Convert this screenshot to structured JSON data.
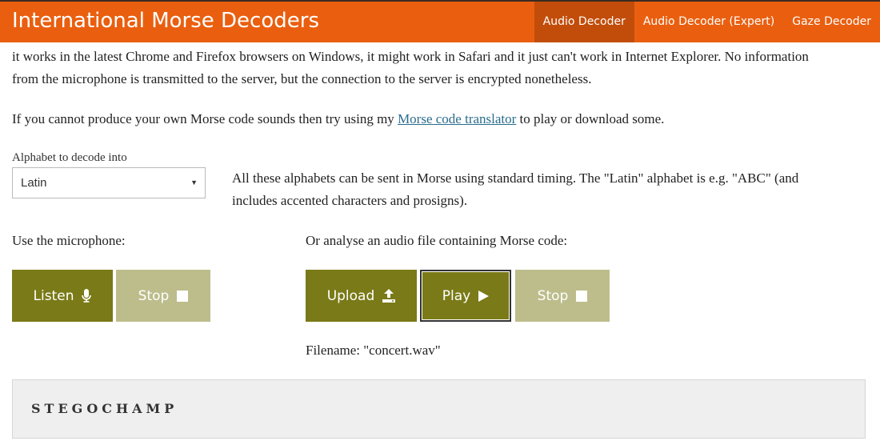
{
  "navbar": {
    "brand": "International Morse Decoders",
    "items": [
      {
        "label": "Audio Decoder",
        "active": true
      },
      {
        "label": "Audio Decoder (Expert)",
        "active": false
      },
      {
        "label": "Gaze Decoder",
        "active": false
      }
    ]
  },
  "intro": {
    "line1": "it works in the latest Chrome and Firefox browsers on Windows, it might work in Safari and it just can't work in Internet Explorer. No information",
    "line2": "from the microphone is transmitted to the server, but the connection to the server is encrypted nonetheless.",
    "translator_prefix": "If you cannot produce your own Morse code sounds then try using my ",
    "translator_link": "Morse code translator",
    "translator_suffix": " to play or download some."
  },
  "alphabet": {
    "label": "Alphabet to decode into",
    "selected": "Latin",
    "description_line1": "All these alphabets can be sent in Morse using standard timing. The \"Latin\" alphabet is e.g. \"ABC\" (and",
    "description_line2": "includes accented characters and prosigns)."
  },
  "microphone": {
    "label": "Use the microphone:",
    "listen": "Listen",
    "stop": "Stop"
  },
  "audio_file": {
    "label": "Or analyse an audio file containing Morse code:",
    "upload": "Upload",
    "play": "Play",
    "stop": "Stop",
    "filename_label": "Filename: \"concert.wav\""
  },
  "output": {
    "text": "STEGOCHAMP"
  },
  "colors": {
    "navbar": "#ea5f0f",
    "nav_active": "#c24d0a",
    "button_active": "#7a7a18",
    "button_disabled": "#bdbd8c",
    "link": "#2a6c8c"
  },
  "icons": {
    "listen": "microphone-icon",
    "upload": "upload-icon",
    "play": "play-icon",
    "stop": "stop-square-icon",
    "select": "caret-down-icon"
  }
}
